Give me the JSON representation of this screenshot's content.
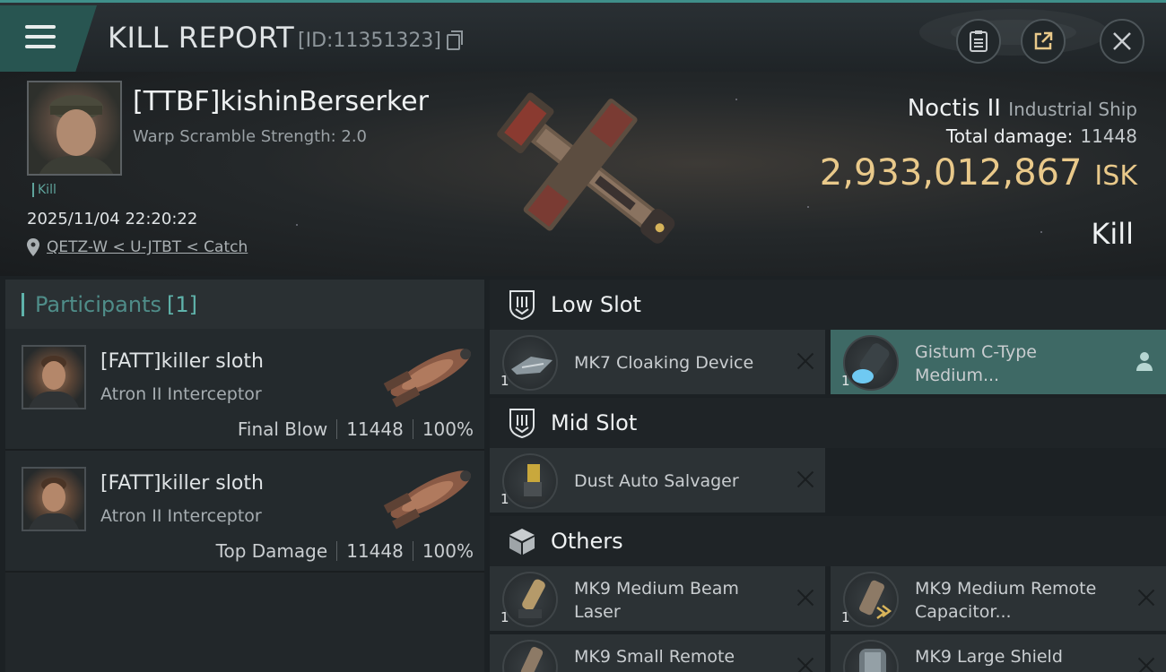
{
  "header": {
    "title": "KILL REPORT",
    "kill_id": "[ID:11351323]",
    "buttons": [
      "clipboard",
      "share",
      "close"
    ]
  },
  "victim": {
    "name": "[TTBF]kishinBerserker",
    "subtitle": "Warp Scramble Strength: 2.0",
    "tag": "Kill",
    "datetime": "2025/11/04 22:20:22",
    "location": "QETZ-W < U-JTBT < Catch",
    "ship_name": "Noctis II",
    "ship_class": "Industrial Ship",
    "total_damage_label": "Total damage:",
    "total_damage": "11448",
    "isk_value": "2,933,012,867",
    "isk_unit": "ISK",
    "result": "Kill"
  },
  "participants": {
    "label": "Participants",
    "count": "[1]",
    "rows": [
      {
        "name": "[FATT]killer sloth",
        "ship": "Atron II Interceptor",
        "role": "Final Blow",
        "damage": "11448",
        "percent": "100%"
      },
      {
        "name": "[FATT]killer sloth",
        "ship": "Atron II Interceptor",
        "role": "Top Damage",
        "damage": "11448",
        "percent": "100%"
      }
    ]
  },
  "slots": {
    "low": {
      "title": "Low Slot",
      "items": [
        {
          "name": "MK7 Cloaking Device",
          "qty": "1"
        },
        {
          "name": "Gistum C-Type Medium...",
          "qty": "1"
        }
      ]
    },
    "mid": {
      "title": "Mid Slot",
      "items": [
        {
          "name": "Dust Auto Salvager",
          "qty": "1"
        }
      ]
    },
    "others": {
      "title": "Others",
      "items": [
        {
          "name": "MK9 Medium Beam Laser",
          "qty": "1"
        },
        {
          "name": "MK9 Medium Remote Capacitor...",
          "qty": "1"
        },
        {
          "name": "MK9 Small Remote",
          "qty": ""
        },
        {
          "name": "MK9 Large Shield",
          "qty": ""
        }
      ]
    }
  },
  "colors": {
    "accent": "#5fb3ab",
    "isk": "#e9c98a",
    "selected_item": "#3e6965"
  }
}
